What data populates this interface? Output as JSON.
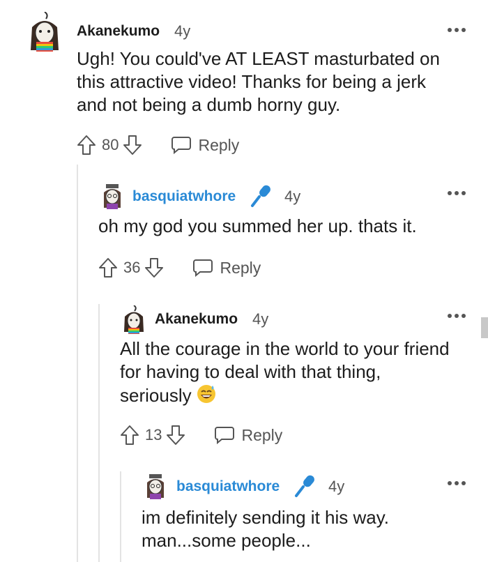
{
  "comments": [
    {
      "username": "Akanekumo",
      "time": "4y",
      "lines": [
        "Ugh! You could've AT LEAST masturbated on",
        "this attractive video! Thanks for being a jerk",
        "and not being a dumb horny guy."
      ],
      "votes": "80",
      "reply_label": "Reply"
    },
    {
      "username": "basquiatwhore",
      "time": "4y",
      "lines": [
        "oh my god you summed her up. thats it."
      ],
      "votes": "36",
      "reply_label": "Reply"
    },
    {
      "username": "Akanekumo",
      "time": "4y",
      "lines": [
        "All the courage in the world to your friend",
        "for having to deal with that thing,",
        "seriously"
      ],
      "votes": "13",
      "reply_label": "Reply"
    },
    {
      "username": "basquiatwhore",
      "time": "4y",
      "lines": [
        "im definitely sending it his way.",
        "man...some people..."
      ]
    }
  ],
  "colors": {
    "flair_username": "#2a8ad6",
    "thread_line": "#e3e3e3",
    "muted_text": "#555555"
  },
  "icons": {
    "upvote": "arrow-up-outline",
    "downvote": "arrow-down-outline",
    "reply": "speech-bubble-outline",
    "more": "three-dots-horizontal",
    "flair": "microphone",
    "emoji": "grinning-sweat"
  }
}
